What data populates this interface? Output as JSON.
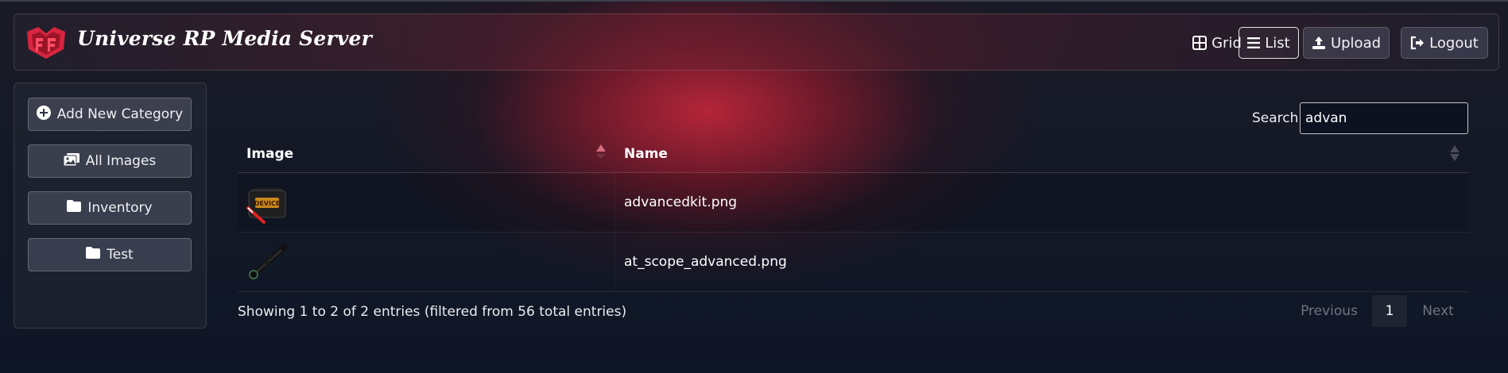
{
  "header": {
    "brand": "Universe RP Media Server",
    "nav": {
      "grid_label": "Grid",
      "list_label": "List",
      "upload_label": "Upload",
      "logout_label": "Logout"
    }
  },
  "sidebar": {
    "add_category_label": "Add New Category",
    "items": [
      {
        "label": "All Images",
        "icon": "images-icon"
      },
      {
        "label": "Inventory",
        "icon": "folder-icon"
      },
      {
        "label": "Test",
        "icon": "folder-icon"
      }
    ]
  },
  "search": {
    "label": "Search:",
    "value": "advan"
  },
  "table": {
    "columns": [
      "Image",
      "Name"
    ],
    "rows": [
      {
        "name": "advancedkit.png",
        "thumb": "advanced-kit-case"
      },
      {
        "name": "at_scope_advanced.png",
        "thumb": "rifle-scope"
      }
    ],
    "thumb_text": "DEVICE",
    "info": "Showing 1 to 2 of 2 entries (filtered from 56 total entries)"
  },
  "pagination": {
    "previous": "Previous",
    "current": "1",
    "next": "Next"
  },
  "colors": {
    "accent": "#c82a40",
    "background": "#121826"
  }
}
